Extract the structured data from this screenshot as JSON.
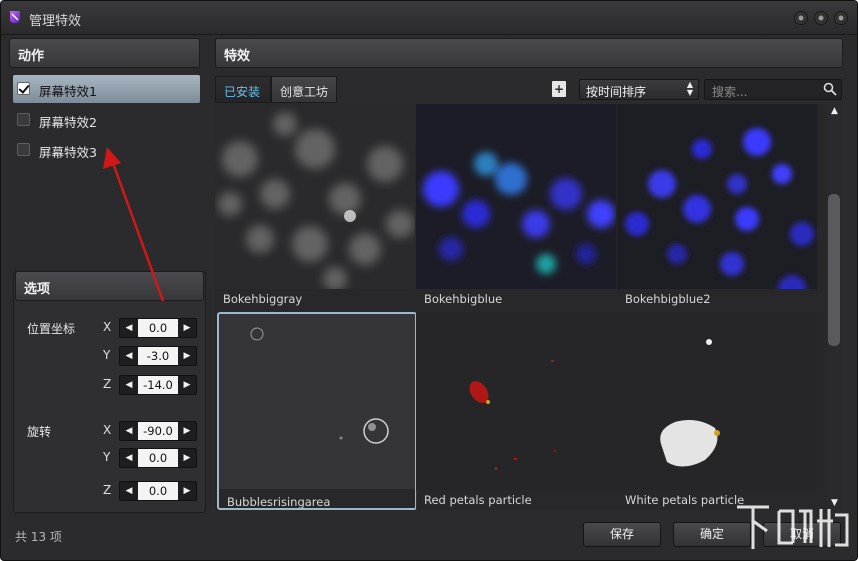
{
  "window": {
    "title": "管理特效"
  },
  "actions": {
    "header": "动作",
    "items": [
      {
        "label": "屏幕特效1",
        "checked": true,
        "selected": true
      },
      {
        "label": "屏幕特效2",
        "checked": false,
        "selected": false
      },
      {
        "label": "屏幕特效3",
        "checked": false,
        "selected": false
      }
    ]
  },
  "options": {
    "header": "选项",
    "position": {
      "label": "位置坐标",
      "x_label": "X",
      "x_value": "0.0",
      "y_label": "Y",
      "y_value": "-3.0",
      "z_label": "Z",
      "z_value": "-14.0"
    },
    "rotation": {
      "label": "旋转",
      "x_label": "X",
      "x_value": "-90.0",
      "y_label": "Y",
      "y_value": "0.0",
      "z_label": "Z",
      "z_value": "0.0"
    }
  },
  "effects": {
    "header": "特效",
    "tabs": [
      {
        "label": "已安装",
        "active": true
      },
      {
        "label": "创意工坊",
        "active": false
      }
    ],
    "sort_value": "按时间排序",
    "search_placeholder": "搜索...",
    "items": [
      {
        "name": "Bokehbiggray",
        "icon": "bokeh-gray",
        "selected": false
      },
      {
        "name": "Bokehbigblue",
        "icon": "bokeh-blue",
        "selected": false
      },
      {
        "name": "Bokehbigblue2",
        "icon": "bokeh-blue2",
        "selected": false
      },
      {
        "name": "Bubblesrisingarea",
        "icon": "bubbles",
        "selected": true
      },
      {
        "name": "Red petals particle",
        "icon": "red-petals",
        "selected": false
      },
      {
        "name": "White petals particle",
        "icon": "white-petals",
        "selected": false
      }
    ]
  },
  "footer": {
    "count": "共 13 项",
    "save_label": "保存",
    "ok_label": "确定",
    "cancel_label": "取消"
  },
  "colors": {
    "accent_tab": "#5fc4f0",
    "arrow": "#d01818",
    "selection": "#9bb8cf"
  },
  "watermark": {
    "text": "下载吧"
  }
}
